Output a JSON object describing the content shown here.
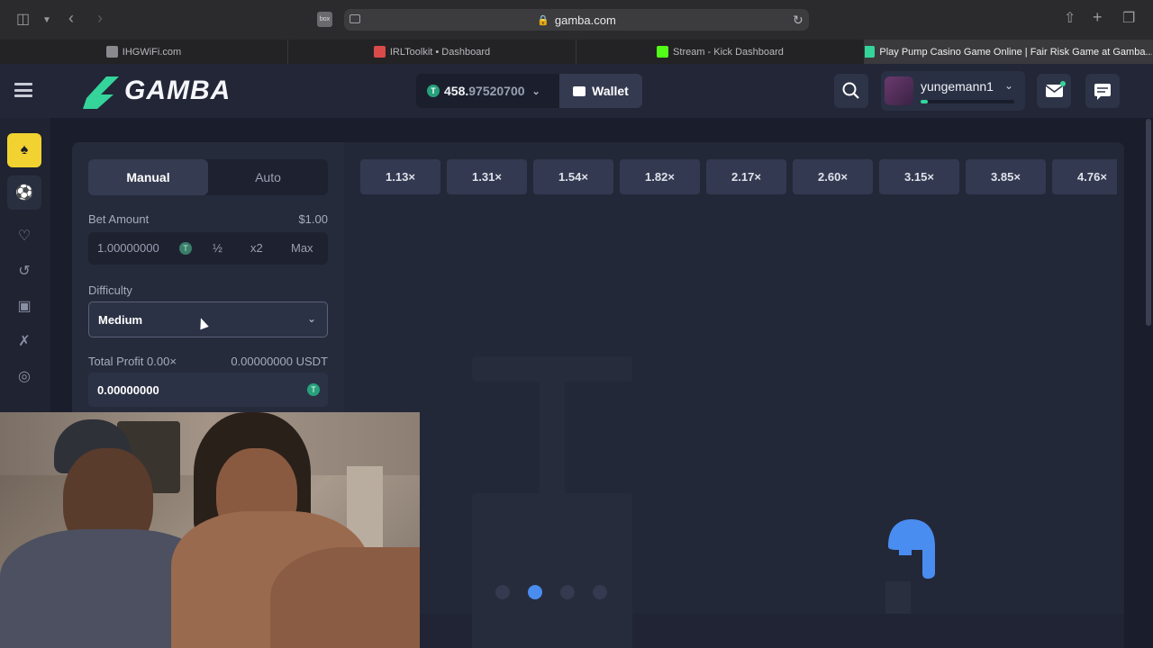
{
  "browser": {
    "url": "gamba.com",
    "ext_badge": "box",
    "tabs": [
      {
        "label": "IHGWiFi.com",
        "fav_color": "#8a8a8e"
      },
      {
        "label": "IRLToolkit • Dashboard",
        "fav_color": "#d94a4a"
      },
      {
        "label": "Stream - Kick Dashboard",
        "fav_color": "#53fc18"
      },
      {
        "label": "Play Pump Casino Game Online | Fair Risk Game at Gamba...",
        "fav_color": "#35d49a",
        "active": true
      }
    ]
  },
  "header": {
    "logo": "GAMBA",
    "balance_whole": "458.",
    "balance_decimals": "97520700",
    "coin_symbol": "T",
    "wallet_label": "Wallet",
    "username": "yungemann1",
    "xp_progress": 0.08
  },
  "controls": {
    "mode_manual": "Manual",
    "mode_auto": "Auto",
    "bet_label": "Bet Amount",
    "bet_usd": "$1.00",
    "bet_amount": "1.00000000",
    "half": "½",
    "double": "x2",
    "max": "Max",
    "difficulty_label": "Difficulty",
    "difficulty_value": "Medium",
    "profit_label": "Total Profit 0.00×",
    "profit_usdt": "0.00000000 USDT",
    "profit_value": "0.00000000"
  },
  "multipliers": [
    "1.13×",
    "1.31×",
    "1.54×",
    "1.82×",
    "2.17×",
    "2.60×",
    "3.15×",
    "3.85×",
    "4.76×"
  ],
  "colors": {
    "accent_yellow": "#f2d231",
    "accent_green": "#35d49a",
    "balloon_blue": "#4a8df0"
  }
}
